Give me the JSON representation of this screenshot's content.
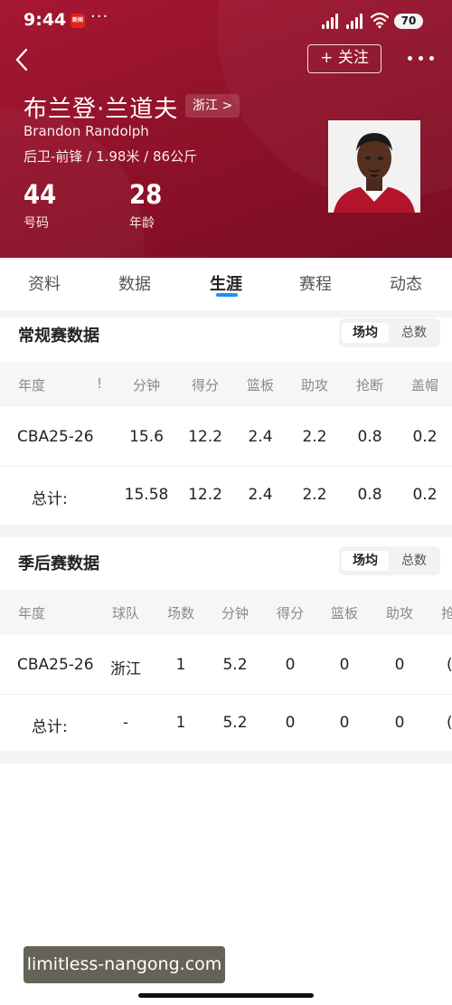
{
  "status_bar": {
    "time": "9:44",
    "app_badge": "新闻",
    "more": "···",
    "battery": "70"
  },
  "nav": {
    "follow_label": "+ 关注"
  },
  "player": {
    "name_cn": "布兰登·兰道夫",
    "team": "浙江 >",
    "name_en": "Brandon Randolph",
    "meta": "后卫-前锋 / 1.98米 / 86公斤",
    "number": "44",
    "number_label": "号码",
    "age": "28",
    "age_label": "年龄"
  },
  "tabs": [
    "资料",
    "数据",
    "生涯",
    "赛程",
    "动态"
  ],
  "active_tab": "生涯",
  "regular": {
    "title": "常规赛数据",
    "toggle": [
      "场均",
      "总数"
    ],
    "headers": [
      "年度",
      "!",
      "分钟",
      "得分",
      "篮板",
      "助攻",
      "抢断",
      "盖帽"
    ],
    "row": [
      "CBA25-26",
      "15.6",
      "12.2",
      "2.4",
      "2.2",
      "0.8",
      "0.2"
    ],
    "total": [
      "总计:",
      "15.58",
      "12.2",
      "2.4",
      "2.2",
      "0.8",
      "0.2"
    ]
  },
  "playoff": {
    "title": "季后赛数据",
    "toggle": [
      "场均",
      "总数"
    ],
    "headers": [
      "年度",
      "球队",
      "场数",
      "分钟",
      "得分",
      "篮板",
      "助攻",
      "抢"
    ],
    "row": [
      "CBA25-26",
      "浙江",
      "1",
      "5.2",
      "0",
      "0",
      "0",
      "("
    ],
    "total": [
      "总计:",
      "-",
      "1",
      "5.2",
      "0",
      "0",
      "0",
      "("
    ]
  },
  "watermark": "limitless-nangong.com",
  "colors": {
    "header_red": "#8c1128",
    "active_tab_indicator": "#1e90ff"
  }
}
